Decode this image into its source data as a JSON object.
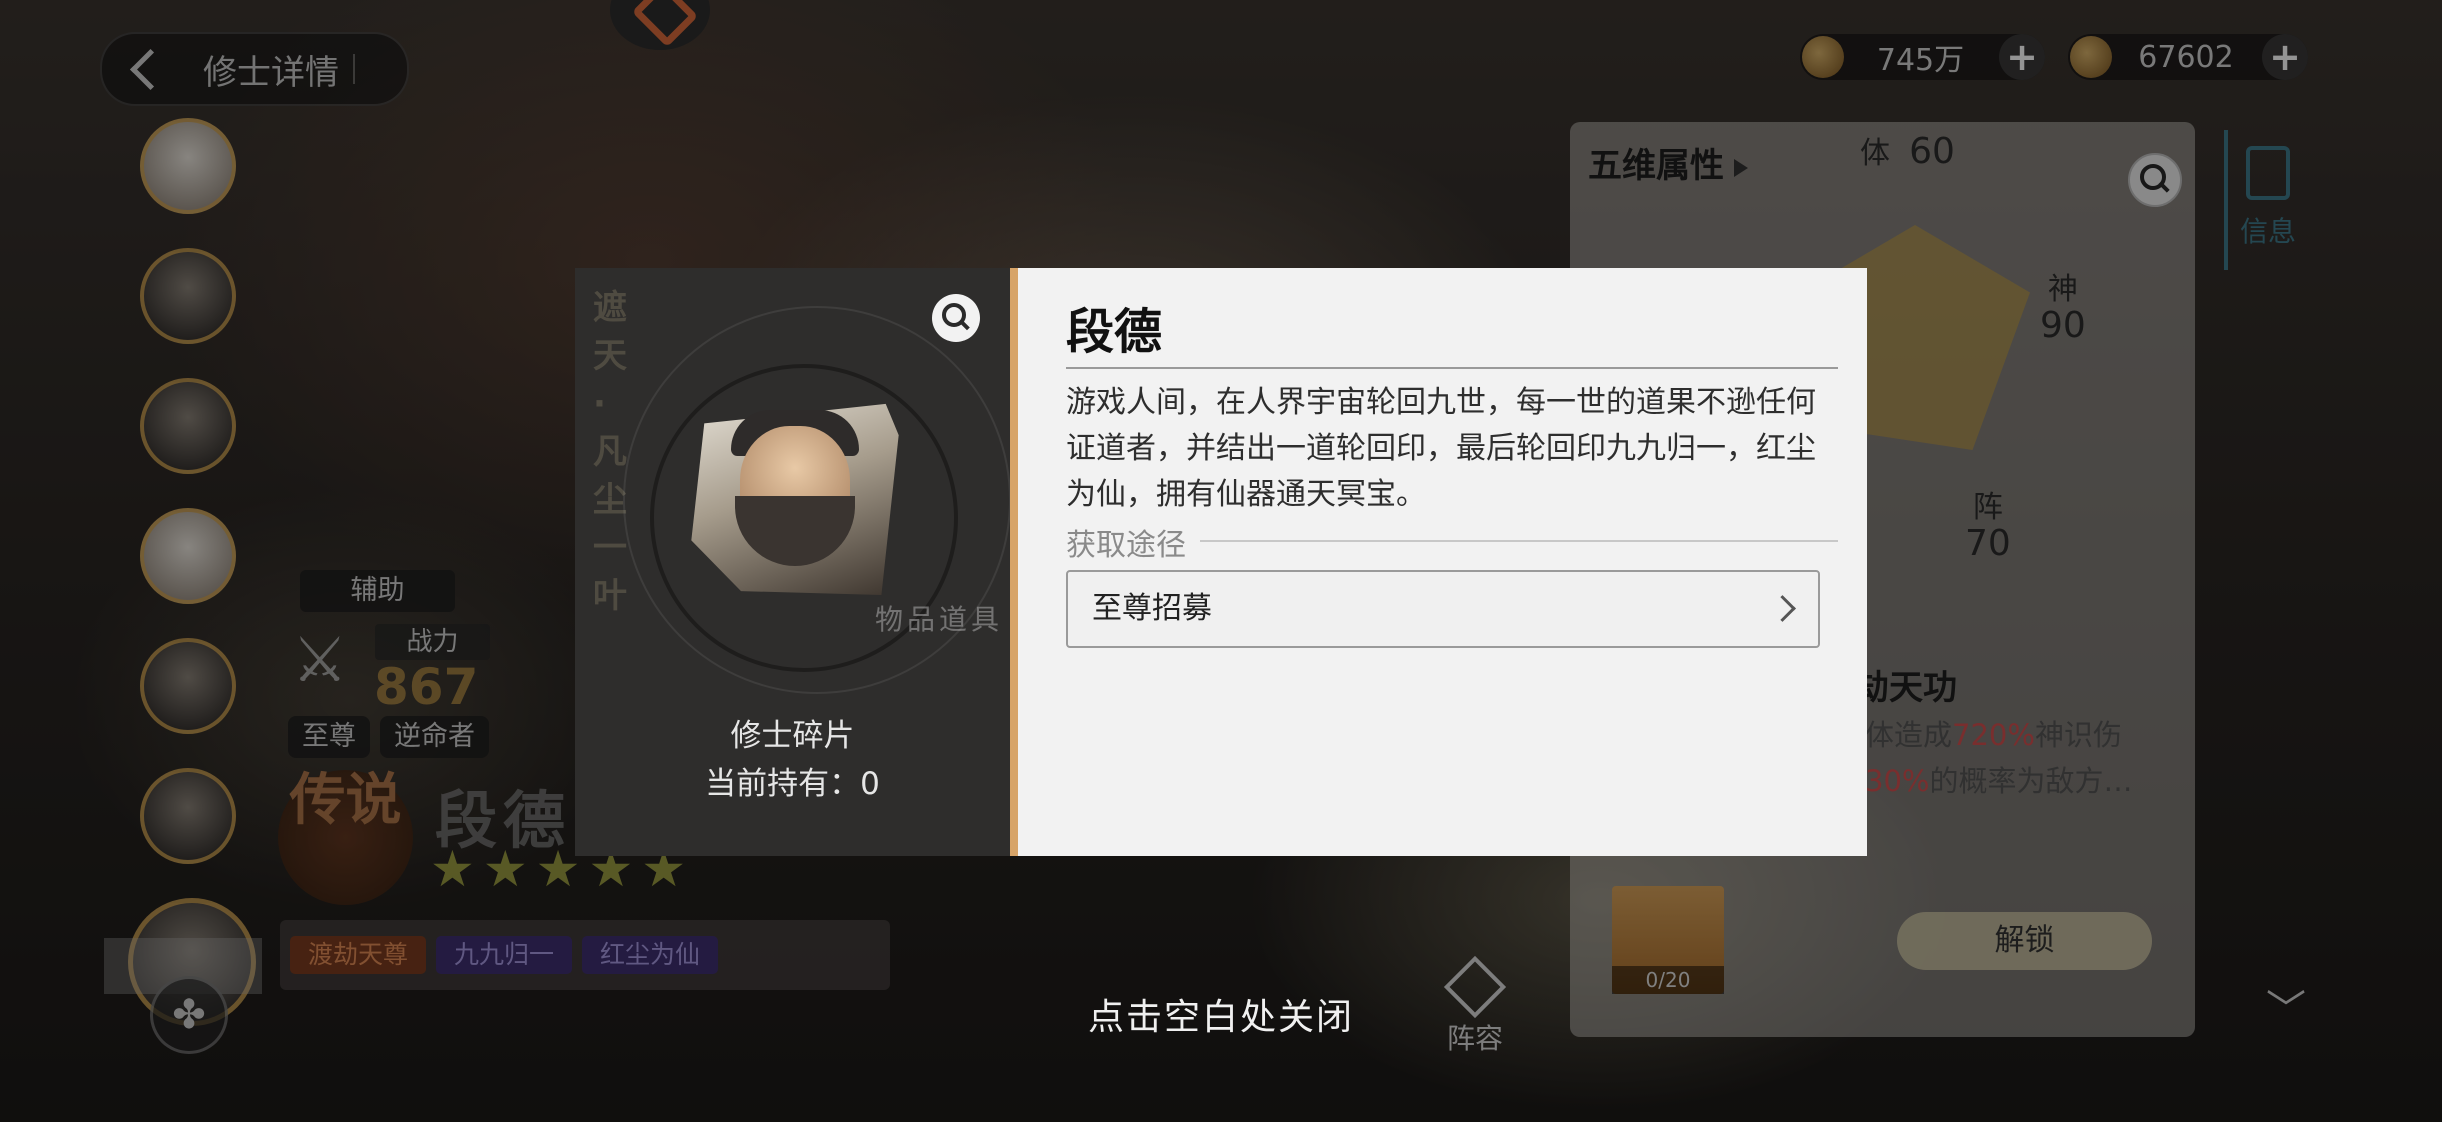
{
  "header": {
    "back_title": "修士详情"
  },
  "currencies": [
    {
      "value": "745万",
      "plus": "+"
    },
    {
      "value": "67602",
      "plus": "+"
    }
  ],
  "character": {
    "role": "辅助",
    "power_label": "战力",
    "power_value": "867",
    "factions": [
      "至尊",
      "逆命者"
    ],
    "rarity": "传说",
    "name": "段德",
    "stars": "★★★★★",
    "skill_tags": [
      "渡劫天尊",
      "九九归一",
      "红尘为仙"
    ]
  },
  "attributes": {
    "title": "五维属性",
    "stats": [
      {
        "label": "体",
        "value": "60"
      },
      {
        "label": "神",
        "value": "90"
      },
      {
        "label": "阵",
        "value": "70"
      }
    ],
    "skill_title": "劫天功",
    "skill_desc_a": "体造成",
    "skill_desc_hl1": "720%",
    "skill_desc_b": "神识伤",
    "skill_desc_hl2": "30%",
    "skill_desc_c": "的概率为敌方…",
    "shard_count": "0/20",
    "unlock_label": "解锁",
    "info_tab": "信息",
    "formation_label": "阵容"
  },
  "popup": {
    "side_text": "遮天·凡尘一叶",
    "items_label": "物品道具",
    "fragment_name": "修士碎片",
    "fragment_count": "当前持有：0",
    "hero_name": "段德",
    "hero_desc": "游戏人间，在人界宇宙轮回九世，每一世的道果不逊任何证道者，并结出一道轮回印，最后轮回印九九归一，红尘为仙，拥有仙器通天冥宝。",
    "source_label": "获取途径",
    "source_item": "至尊招募"
  },
  "close_hint": "点击空白处关闭",
  "colors": {
    "accent_stripe": "#d7a468",
    "highlight_red": "#d05050",
    "info_blue": "#3f7a8c"
  }
}
